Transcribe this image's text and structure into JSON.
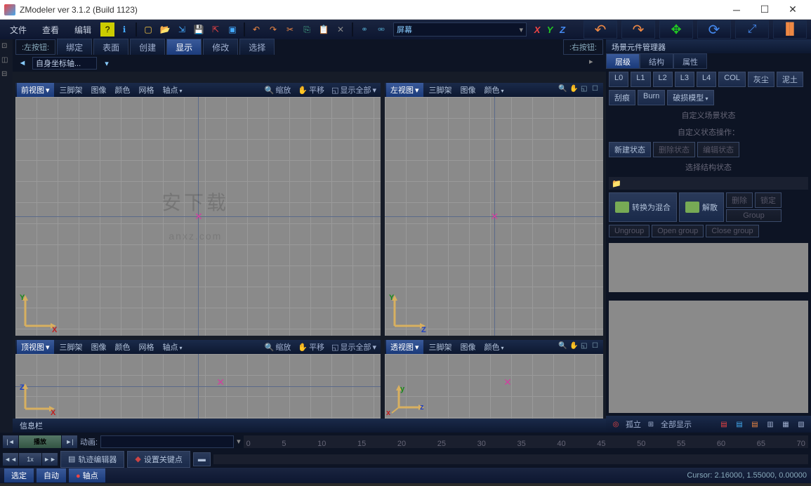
{
  "title": "ZModeler ver 3.1.2 (Build 1123)",
  "menus": [
    "文件",
    "查看",
    "编辑"
  ],
  "screen_dropdown": "屏幕",
  "tabbar": {
    "left": ":左按钮:",
    "right": ":右按钮:",
    "tabs": [
      "绑定",
      "表面",
      "创建",
      "显示",
      "修改",
      "选择"
    ],
    "active": 3
  },
  "coord": {
    "dd": "自身坐标轴..."
  },
  "viewports": {
    "front": {
      "label": "前视图",
      "items": [
        "三脚架",
        "图像",
        "颜色",
        "网格",
        "轴点"
      ],
      "zoom": "缩放",
      "pan": "平移",
      "showall": "显示全部",
      "axis1": "Y",
      "axis2": "X",
      "c1": "#1a8a1a",
      "c2": "#c02020"
    },
    "left": {
      "label": "左视图",
      "items": [
        "三脚架",
        "图像",
        "颜色"
      ],
      "axis1": "Y",
      "axis2": "Z",
      "c1": "#1a8a1a",
      "c2": "#2040c0"
    },
    "top": {
      "label": "顶视图",
      "items": [
        "三脚架",
        "图像",
        "颜色",
        "网格",
        "轴点"
      ],
      "zoom": "缩放",
      "pan": "平移",
      "showall": "显示全部",
      "axis1": "Z",
      "axis2": "X",
      "c1": "#2040c0",
      "c2": "#c02020"
    },
    "persp": {
      "label": "透视图",
      "items": [
        "三脚架",
        "图像",
        "颜色"
      ],
      "axis1": "y",
      "axis2": "x",
      "c1": "#1a8a1a",
      "c2": "#c02020"
    }
  },
  "scene_mgr": {
    "title": "场景元件管理器",
    "tabs": [
      "层级",
      "结构",
      "属性"
    ],
    "lod": [
      "L0",
      "L1",
      "L2",
      "L3",
      "L4",
      "COL",
      "灰尘",
      "泥土"
    ],
    "row2": [
      "刮痕",
      "Burn",
      "破损模型"
    ],
    "sect1": "自定义场景状态",
    "sect2": "自定义状态操作：",
    "state_btns": [
      "新建状态",
      "删除状态",
      "编辑状态"
    ],
    "sect3": "选择结构状态",
    "mix_btn": "转换为混合",
    "ungroup_btn": "解散",
    "del": "删除",
    "lock": "锁定",
    "group": "Group",
    "grp_ops": [
      "Ungroup",
      "Open group",
      "Close group"
    ],
    "isolate": "孤立",
    "showall": "全部显示"
  },
  "infobar": "信息栏",
  "timeline": {
    "play_big": "播放",
    "speed": "1x",
    "anim": "动画:",
    "editor": "轨迹编辑器",
    "keyframe": "设置关键点",
    "ticks": [
      "0",
      "5",
      "10",
      "15",
      "20",
      "25",
      "30",
      "35",
      "40",
      "45",
      "50",
      "55",
      "60",
      "65",
      "70"
    ]
  },
  "status": {
    "btns": [
      "选定",
      "自动",
      "轴点"
    ],
    "cursor": "Cursor: 2.16000, 1.55000, 0.00000"
  }
}
